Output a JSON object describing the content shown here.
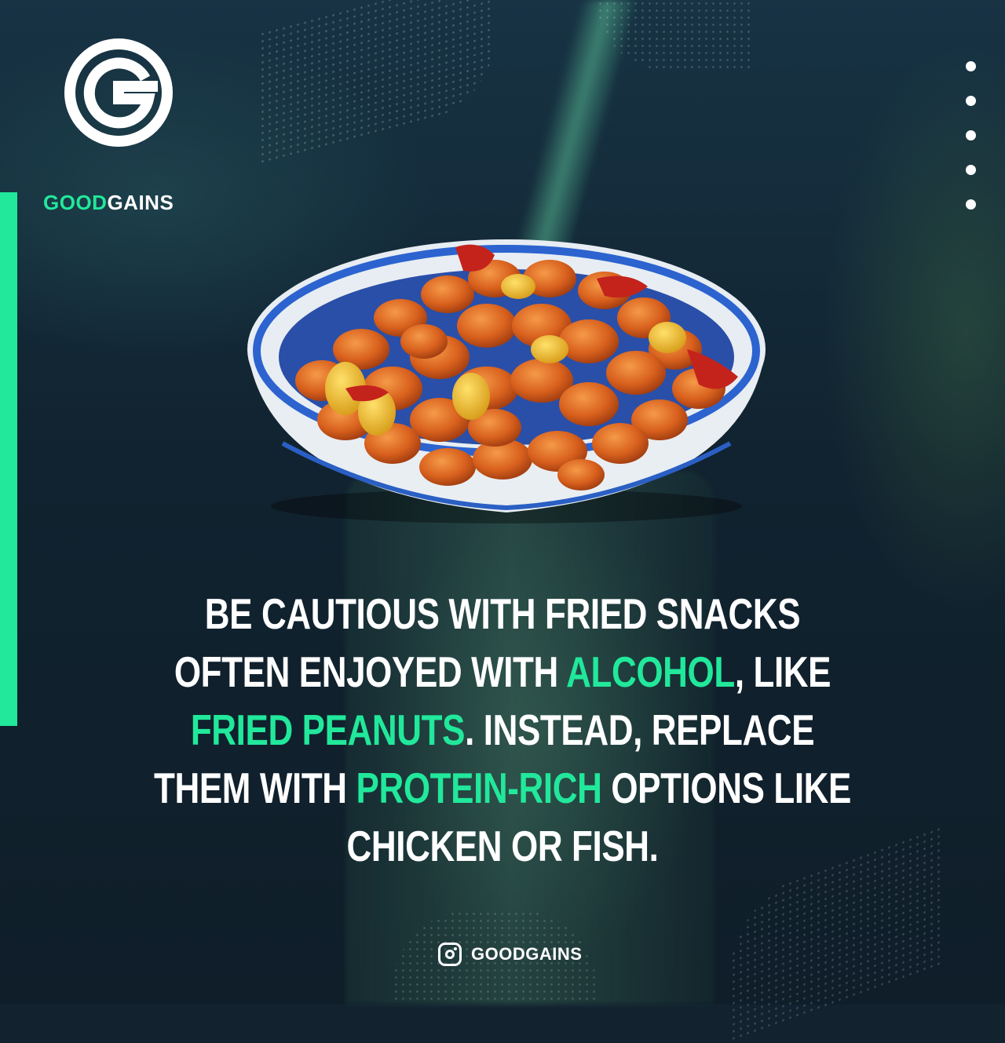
{
  "brand": {
    "name_part1": "GOOD",
    "name_part2": "GAINS",
    "logo_letter": "G",
    "accent_color": "#21e89b"
  },
  "menu": {
    "dot_count": 5,
    "icon": "vertical-dots-icon"
  },
  "image": {
    "subject": "bowl-of-fried-peanuts",
    "icon": "peanut-bowl-illustration"
  },
  "headline": {
    "parts": [
      {
        "text": "Be cautious with fried snacks often enjoyed with ",
        "highlight": false
      },
      {
        "text": "alcohol",
        "highlight": true
      },
      {
        "text": ", like ",
        "highlight": false
      },
      {
        "text": "fried peanuts",
        "highlight": true
      },
      {
        "text": ". Instead, replace them with ",
        "highlight": false
      },
      {
        "text": "protein-rich",
        "highlight": true
      },
      {
        "text": " options like chicken or fish.",
        "highlight": false
      }
    ]
  },
  "footer": {
    "icon": "instagram-icon",
    "handle": "GOODGAINS"
  }
}
